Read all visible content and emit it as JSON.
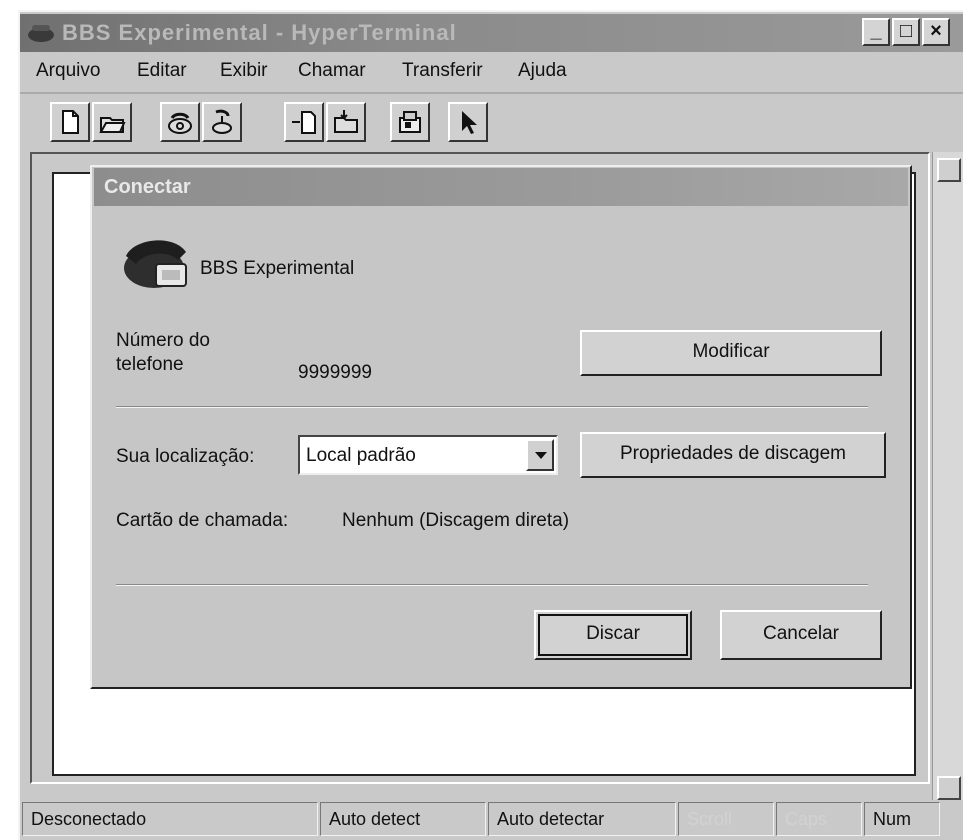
{
  "window": {
    "title": "BBS Experimental - HyperTerminal",
    "controls": {
      "minimize": "_",
      "maximize": "□",
      "close": "×"
    }
  },
  "menu": {
    "items": [
      {
        "label": "Arquivo"
      },
      {
        "label": "Editar"
      },
      {
        "label": "Exibir"
      },
      {
        "label": "Chamar"
      },
      {
        "label": "Transferir"
      },
      {
        "label": "Ajuda"
      }
    ]
  },
  "toolbar": {
    "icons": [
      "new-icon",
      "open-icon",
      "connect-icon",
      "disconnect-icon",
      "send-icon",
      "receive-icon",
      "properties-icon",
      "pointer-icon"
    ]
  },
  "dialog": {
    "title": "Conectar",
    "connection_name": "BBS Experimental",
    "phone_label_line1": "Número do",
    "phone_label_line2": "telefone",
    "phone_number": "9999999",
    "modify_button": "Modificar",
    "location_label": "Sua localização:",
    "location_value": "Local padrão",
    "dialing_props_button": "Propriedades de discagem",
    "calling_card_label": "Cartão de chamada:",
    "calling_card_value": "Nenhum (Discagem direta)",
    "dial_button": "Discar",
    "cancel_button": "Cancelar"
  },
  "statusbar": {
    "status": "Desconectado",
    "detect1": "Auto detect",
    "detect2": "Auto detectar",
    "scroll": "Scroll",
    "caps": "Caps",
    "num": "Num"
  },
  "colors": {
    "titlebar": "#7a7a7a",
    "face": "#c9c9c9"
  }
}
